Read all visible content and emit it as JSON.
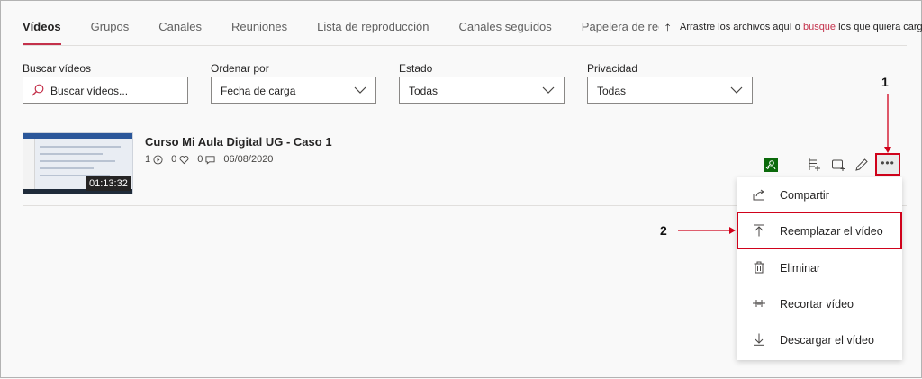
{
  "tabs": [
    {
      "label": "Vídeos",
      "active": true
    },
    {
      "label": "Grupos"
    },
    {
      "label": "Canales"
    },
    {
      "label": "Reuniones"
    },
    {
      "label": "Lista de reproducción"
    },
    {
      "label": "Canales seguidos"
    },
    {
      "label": "Papelera de reciclaje"
    }
  ],
  "upload": {
    "prefix": "Arrastre los archivos aquí o",
    "link": "busque",
    "suffix": "los que quiera cargar."
  },
  "filters": {
    "search": {
      "label": "Buscar vídeos",
      "placeholder": "Buscar vídeos..."
    },
    "sort": {
      "label": "Ordenar por",
      "value": "Fecha de carga"
    },
    "status": {
      "label": "Estado",
      "value": "Todas"
    },
    "privacy": {
      "label": "Privacidad",
      "value": "Todas"
    }
  },
  "video": {
    "title": "Curso Mi Aula Digital UG - Caso 1",
    "views": "1",
    "likes": "0",
    "comments": "0",
    "date": "06/08/2020",
    "duration": "01:13:32"
  },
  "menu": {
    "items": [
      {
        "label": "Compartir",
        "icon": "share-icon"
      },
      {
        "label": "Reemplazar el vídeo",
        "icon": "upload-icon"
      },
      {
        "label": "Eliminar",
        "icon": "trash-icon"
      },
      {
        "label": "Recortar vídeo",
        "icon": "trim-icon"
      },
      {
        "label": "Descargar el vídeo",
        "icon": "download-icon"
      }
    ]
  },
  "annotations": {
    "one": "1",
    "two": "2"
  },
  "colors": {
    "accent": "#c4314b",
    "highlight": "#d0021b",
    "privacy": "#0b6a0b"
  }
}
